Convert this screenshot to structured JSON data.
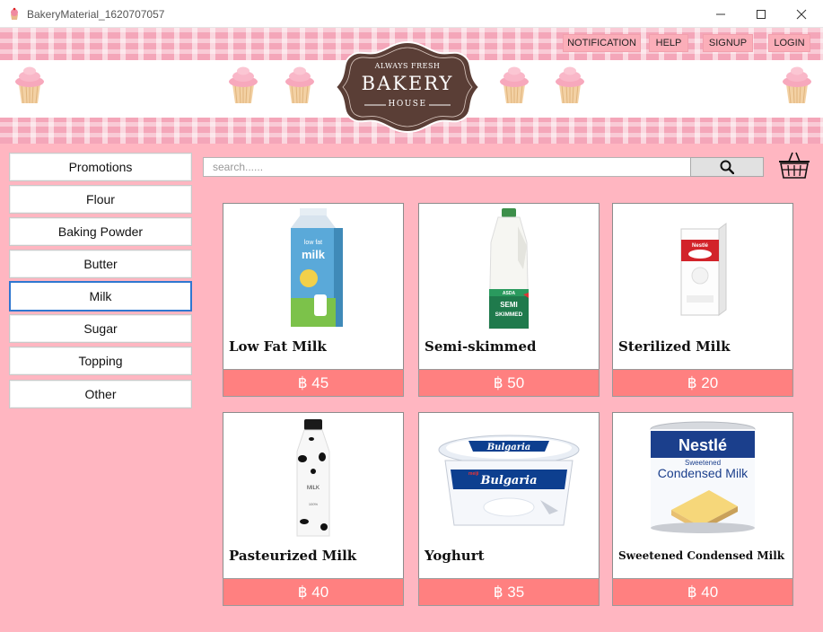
{
  "window": {
    "title": "BakeryMaterial_1620707057"
  },
  "header": {
    "logo": {
      "top_text": "ALWAYS FRESH",
      "main_text": "BAKERY",
      "bottom_text": "HOUSE"
    },
    "nav": [
      {
        "label": "NOTIFICATION"
      },
      {
        "label": "HELP"
      },
      {
        "label": "SIGNUP"
      },
      {
        "label": "LOGIN"
      }
    ]
  },
  "sidebar": {
    "items": [
      {
        "label": "Promotions"
      },
      {
        "label": "Flour"
      },
      {
        "label": "Baking Powder"
      },
      {
        "label": "Butter"
      },
      {
        "label": "Milk",
        "active": true
      },
      {
        "label": "Sugar"
      },
      {
        "label": "Topping"
      },
      {
        "label": "Other"
      }
    ]
  },
  "search": {
    "placeholder": "search......"
  },
  "products": [
    {
      "name": "Low Fat Milk",
      "price": "฿ 45",
      "icon": "milk-carton"
    },
    {
      "name": "Semi-skimmed",
      "price": "฿ 50",
      "icon": "milk-jug"
    },
    {
      "name": "Sterilized Milk",
      "price": "฿ 20",
      "icon": "milk-box"
    },
    {
      "name": "Pasteurized Milk",
      "price": "฿ 40",
      "icon": "milk-bottle"
    },
    {
      "name": "Yoghurt",
      "price": "฿ 35",
      "icon": "yoghurt-tub"
    },
    {
      "name": "Sweetened Condensed Milk",
      "price": "฿ 40",
      "icon": "condensed-milk-can"
    }
  ],
  "colors": {
    "background": "#ffb6c1",
    "price_bar": "#ff8080",
    "active_border": "#2f77d0",
    "logo_brown": "#5a3e36"
  }
}
